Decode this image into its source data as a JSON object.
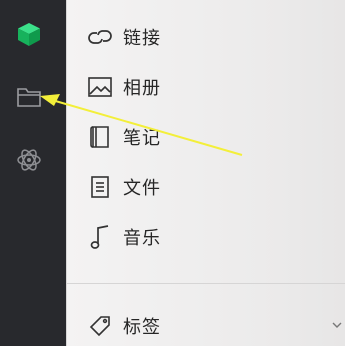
{
  "sidebar": {
    "items": [
      {
        "icon": "green-cube-icon"
      },
      {
        "icon": "folder-icon"
      },
      {
        "icon": "atom-icon"
      }
    ]
  },
  "menu": {
    "items": [
      {
        "label": "链接",
        "icon": "link-icon"
      },
      {
        "label": "相册",
        "icon": "image-icon"
      },
      {
        "label": "笔记",
        "icon": "notebook-icon"
      },
      {
        "label": "文件",
        "icon": "document-icon"
      },
      {
        "label": "音乐",
        "icon": "music-note-icon"
      }
    ],
    "tag": {
      "label": "标签",
      "icon": "tag-icon"
    }
  },
  "colors": {
    "sidebar_bg": "#28292d",
    "brand_green": "#1ec76a",
    "annotation_arrow": "#f3ef3a"
  }
}
